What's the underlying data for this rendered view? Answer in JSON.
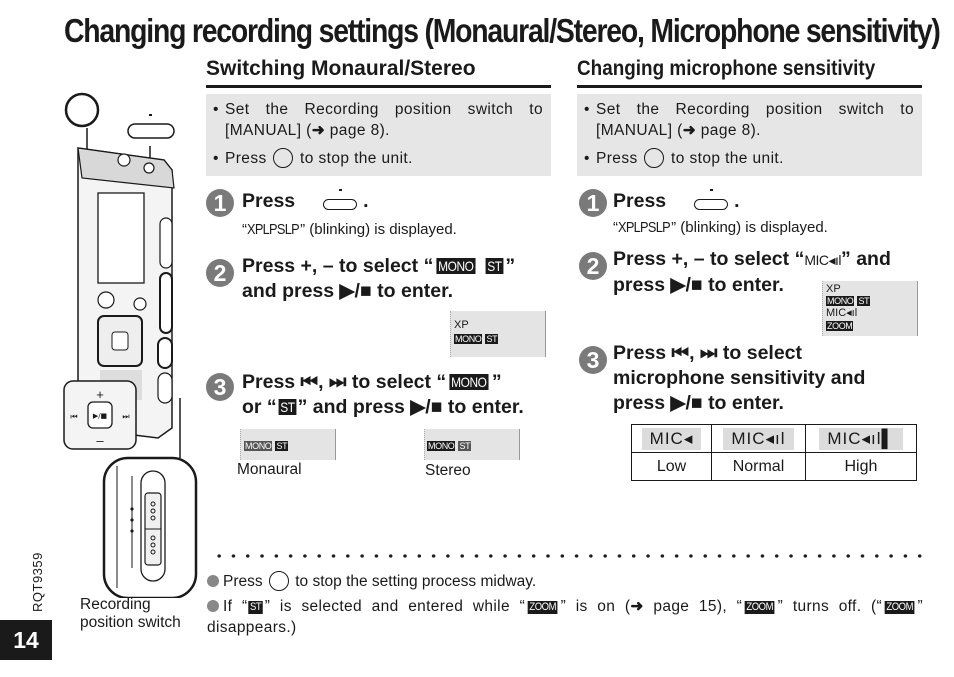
{
  "page": {
    "title": "Changing recording settings (Monaural/Stereo, Microphone sensitivity)",
    "page_number": "14",
    "doc_code": "RQT9359"
  },
  "illustration": {
    "caption_line1": "Recording",
    "caption_line2": "position switch",
    "pad_plus": "+",
    "pad_minus": "–",
    "pad_prev": "⏮",
    "pad_next": "⏭",
    "pad_play": "▶/■"
  },
  "left": {
    "heading": "Switching Monaural/Stereo",
    "notes": [
      {
        "text_before": "Set the Recording position switch to [MANUAL] (",
        "arrow": "➜",
        "text_after": " page 8)."
      },
      {
        "text_before": "Press ",
        "text_after": " to stop the unit."
      }
    ],
    "step1": {
      "number": "1",
      "label": "Press",
      "period": ".",
      "sub_quote_open": "“",
      "sub_lcd": "XPLPSLP",
      "sub_rest": "” (blinking) is displayed."
    },
    "step2": {
      "number": "2",
      "line1_before": "Press +, – to select “",
      "tag1": "MONO",
      "tag2": "ST",
      "line1_after": "”",
      "line2": "and press ▶/■ to enter."
    },
    "step2_display": {
      "row1": "XP",
      "tag1": "MONO",
      "tag2": "ST"
    },
    "step3": {
      "number": "3",
      "line1_before": "Press ⏮, ⏭ to select “",
      "tag_mono": "MONO",
      "line1_after": "”",
      "line2_before": "or “",
      "tag_st": "ST",
      "line2_after": "” and press ▶/■ to enter."
    },
    "step3_displays": [
      {
        "tag1": "MONO",
        "tag2": "ST",
        "caption": "Monaural"
      },
      {
        "tag1": "MONO",
        "tag2": "ST",
        "caption": "Stereo"
      }
    ]
  },
  "right": {
    "heading": "Changing microphone sensitivity",
    "notes": [
      {
        "text_before": "Set the Recording position switch to [MANUAL] (",
        "arrow": "➜",
        "text_after": " page 8)."
      },
      {
        "text_before": "Press ",
        "text_after": " to stop the unit."
      }
    ],
    "step1": {
      "number": "1",
      "label": "Press",
      "period": ".",
      "sub_quote_open": "“",
      "sub_lcd": "XPLPSLP",
      "sub_rest": "” (blinking) is displayed."
    },
    "step2": {
      "number": "2",
      "line1_before": "Press +, – to select “",
      "tag": "MIC◂ıl",
      "line1_after": "” and",
      "line2": "press ▶/■ to enter."
    },
    "step2_display": {
      "row1": "XP",
      "tag1": "MONO",
      "tag2": "ST",
      "row3": "MIC◂ıl",
      "row4": "ZOOM"
    },
    "step3": {
      "number": "3",
      "line1": "Press ⏮, ⏭ to select",
      "line2": "microphone sensitivity and",
      "line3": "press ▶/■ to enter."
    },
    "sensitivity_table": {
      "icons": [
        "MIC◂",
        "MIC◂ıl",
        "MIC◂ıl▌"
      ],
      "labels": [
        "Low",
        "Normal",
        "High"
      ]
    }
  },
  "footnotes": {
    "note1_before": "Press ",
    "note1_after": " to stop the setting process midway.",
    "note2_p1": "If “",
    "note2_tag_st": "ST",
    "note2_p2": "” is selected and entered while “",
    "note2_tag_zoom": "ZOOM",
    "note2_p3": "” is on (",
    "note2_arrow": "➜",
    "note2_p4": " page 15), “",
    "note2_tag_zoom2": "ZOOM",
    "note2_p5": "” turns off. (“",
    "note2_tag_zoom3": "ZOOM",
    "note2_p6": "” disappears.)"
  }
}
